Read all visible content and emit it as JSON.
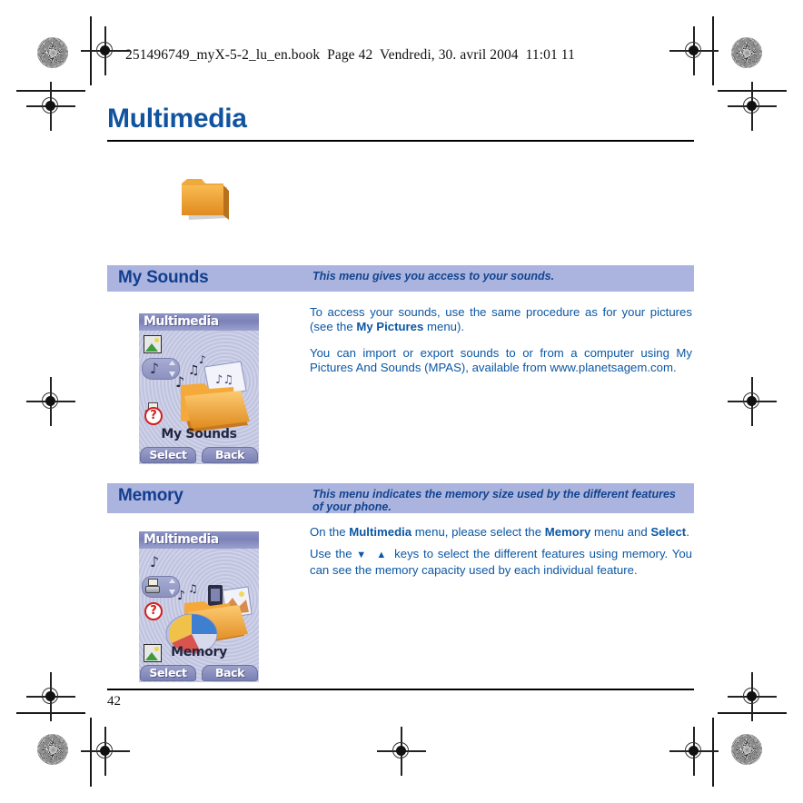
{
  "document": {
    "book_header": "251496749_myX-5-2_lu_en.book  Page 42  Vendredi, 30. avril 2004  11:01 11",
    "chapter_title": "Multimedia",
    "page_number": "42",
    "colors": {
      "title_blue": "#10539f",
      "body_blue": "#0b57a4",
      "section_bar": "#aab4de",
      "section_text": "#123d8f"
    },
    "folder_icon": "folder-icon"
  },
  "sections": [
    {
      "id": "my-sounds",
      "name": "My Sounds",
      "description": "This menu gives you access to your sounds.",
      "phone": {
        "title": "Multimedia",
        "label": "My Sounds",
        "softkey_left": "Select",
        "softkey_right": "Back",
        "rail_icons": [
          "picture-icon",
          "music-note-icon",
          "printer-icon",
          "help-icon"
        ],
        "selected_rail_icon": "music-note-icon"
      },
      "paragraphs": [
        {
          "runs": [
            {
              "text": "To access your sounds, use the same procedure as for your pictures (see the ",
              "bold": false
            },
            {
              "text": "My Pictures",
              "bold": true
            },
            {
              "text": " menu).",
              "bold": false
            }
          ]
        },
        {
          "runs": [
            {
              "text": "You can import or export sounds to or from a computer using My Pictures And Sounds (MPAS), available from www.planetsagem.com.",
              "bold": false
            }
          ]
        }
      ]
    },
    {
      "id": "memory",
      "name": "Memory",
      "description": "This menu indicates the memory size used by the different features of your phone.",
      "phone": {
        "title": "Multimedia",
        "label": "Memory",
        "softkey_left": "Select",
        "softkey_right": "Back",
        "rail_icons": [
          "music-note-icon",
          "printer-icon",
          "help-icon",
          "picture-icon"
        ],
        "selected_rail_icon": "printer-icon"
      },
      "paragraphs": [
        {
          "runs": [
            {
              "text": "On the ",
              "bold": false
            },
            {
              "text": "Multimedia",
              "bold": true
            },
            {
              "text": " menu, please select the ",
              "bold": false
            },
            {
              "text": "Memory",
              "bold": true
            },
            {
              "text": " menu and ",
              "bold": false
            },
            {
              "text": "Select",
              "bold": true
            },
            {
              "text": ".",
              "bold": false
            }
          ]
        },
        {
          "runs": [
            {
              "text": "Use the ",
              "bold": false
            },
            {
              "text": "▼ ▲",
              "bold": false,
              "arrows": true
            },
            {
              "text": " keys to select the different features using memory. You can see the memory capacity used by each individual feature.",
              "bold": false
            }
          ]
        }
      ]
    }
  ],
  "print_marks": {
    "registration_target": "registration-target-icon",
    "rosette": "color-rosette-icon"
  }
}
